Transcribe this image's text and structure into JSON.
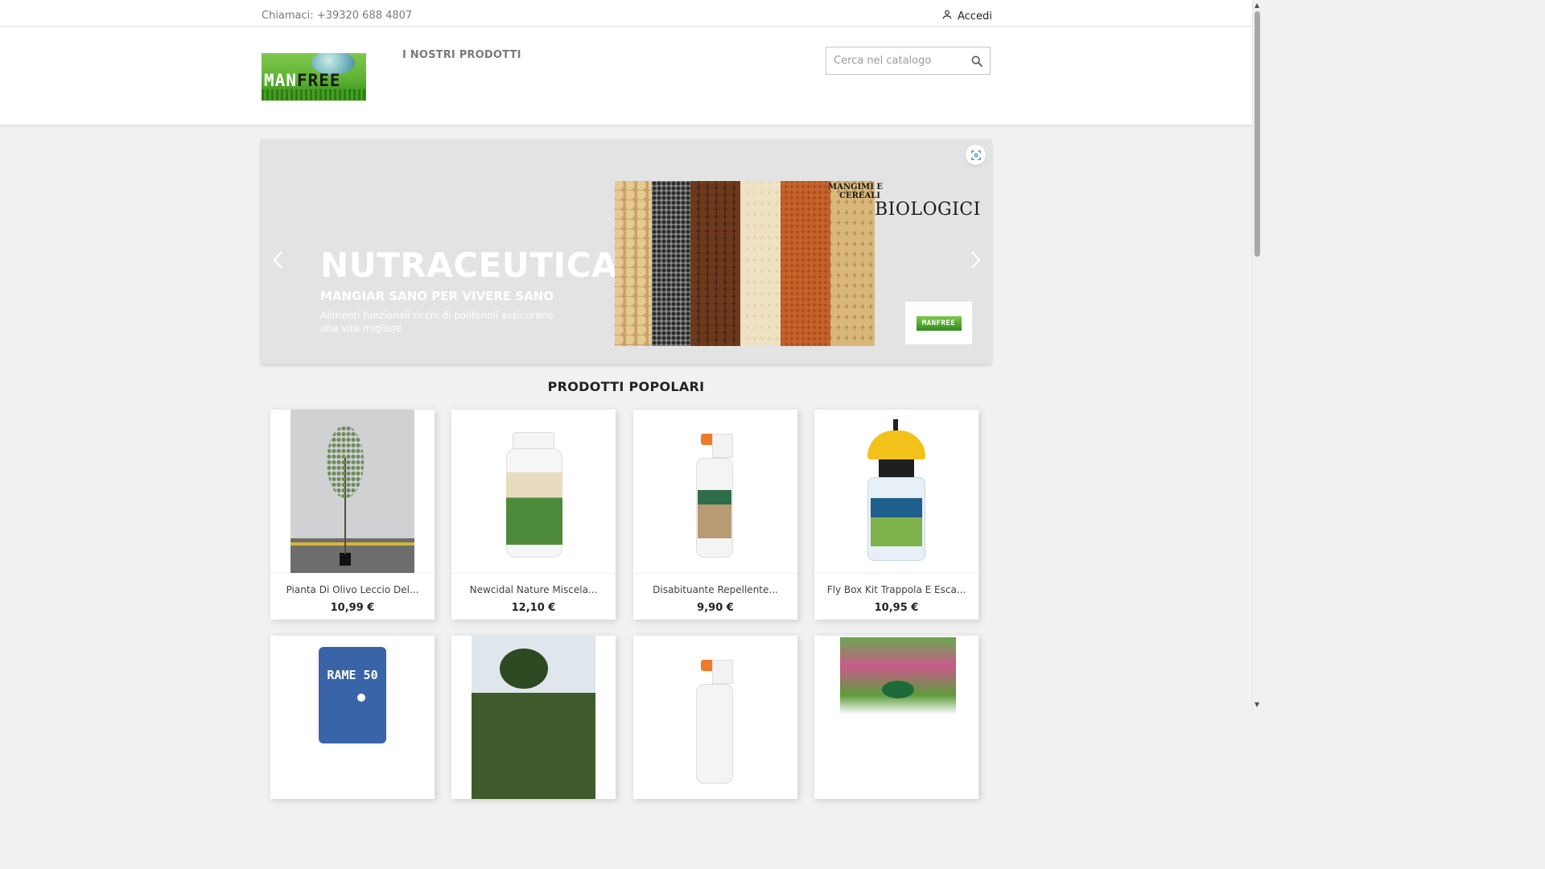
{
  "topbar": {
    "phone": "Chiamaci: +39320 688 4807",
    "login_label": "Accedi"
  },
  "header": {
    "logo_alt": "MANFREE",
    "logo_word_1": "MAN",
    "logo_word_2": "FREE",
    "nav_products": "I NOSTRI PRODOTTI",
    "search_placeholder": "Cerca nel catalogo"
  },
  "carousel": {
    "title": "NUTRACEUTICA",
    "subtitle": "MANGIAR SANO PER VIVERE SANO",
    "description": "Alimenti funzionali ricchi di polifenoli assicurano una vita migliore",
    "image_caption_1": "MANGIMI E",
    "image_caption_2": "CEREALI",
    "image_caption_3": "BIOLOGICI",
    "badge_text": "MANFREE"
  },
  "popular": {
    "title": "PRODOTTI POPOLARI",
    "products": [
      {
        "name": "Pianta Di Olivo Leccio Del...",
        "price": "10,99 €"
      },
      {
        "name": "Newcidal Nature Miscela...",
        "price": "12,10 €"
      },
      {
        "name": "Disabituante Repellente...",
        "price": "9,90 €"
      },
      {
        "name": "Fly Box Kit Trappola E Esca...",
        "price": "10,95 €"
      },
      {
        "name": "",
        "price": "",
        "image_label": "RAME 50"
      },
      {
        "name": "",
        "price": ""
      },
      {
        "name": "",
        "price": ""
      },
      {
        "name": "",
        "price": ""
      }
    ]
  },
  "icons": {
    "user": "user-icon",
    "search": "search-icon",
    "expand": "expand-icon",
    "prev": "chevron-left-icon",
    "next": "chevron-right-icon"
  },
  "colors": {
    "brand_green": "#5fb233",
    "text_dark": "#232323",
    "text_muted": "#7a7a7a",
    "page_bg": "#f1f1f1"
  }
}
